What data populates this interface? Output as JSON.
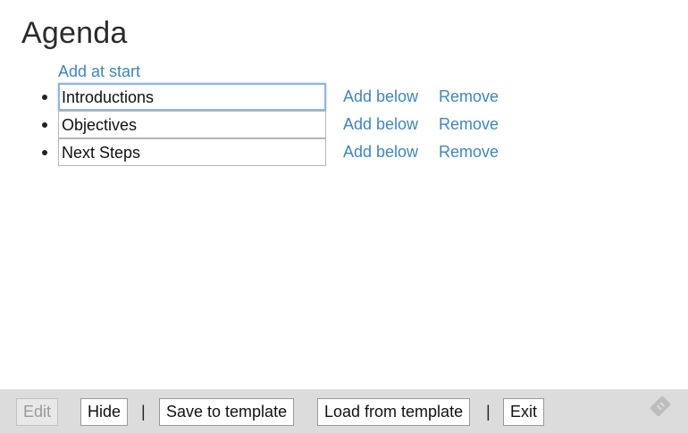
{
  "page": {
    "title": "Agenda",
    "add_at_start_label": "Add at start"
  },
  "agenda": {
    "items": [
      {
        "value": "Introductions",
        "focused": true
      },
      {
        "value": "Objectives",
        "focused": false
      },
      {
        "value": "Next Steps",
        "focused": false
      }
    ],
    "add_below_label": "Add below",
    "remove_label": "Remove"
  },
  "toolbar": {
    "edit_label": "Edit",
    "hide_label": "Hide",
    "separator": "|",
    "save_template_label": "Save to template",
    "load_template_label": "Load from template",
    "exit_label": "Exit"
  },
  "icons": {
    "corner": "feather-icon"
  },
  "colors": {
    "link": "#3d86c6",
    "toolbar_bg": "#dcdcdc",
    "focus_border": "#8db6e4"
  }
}
